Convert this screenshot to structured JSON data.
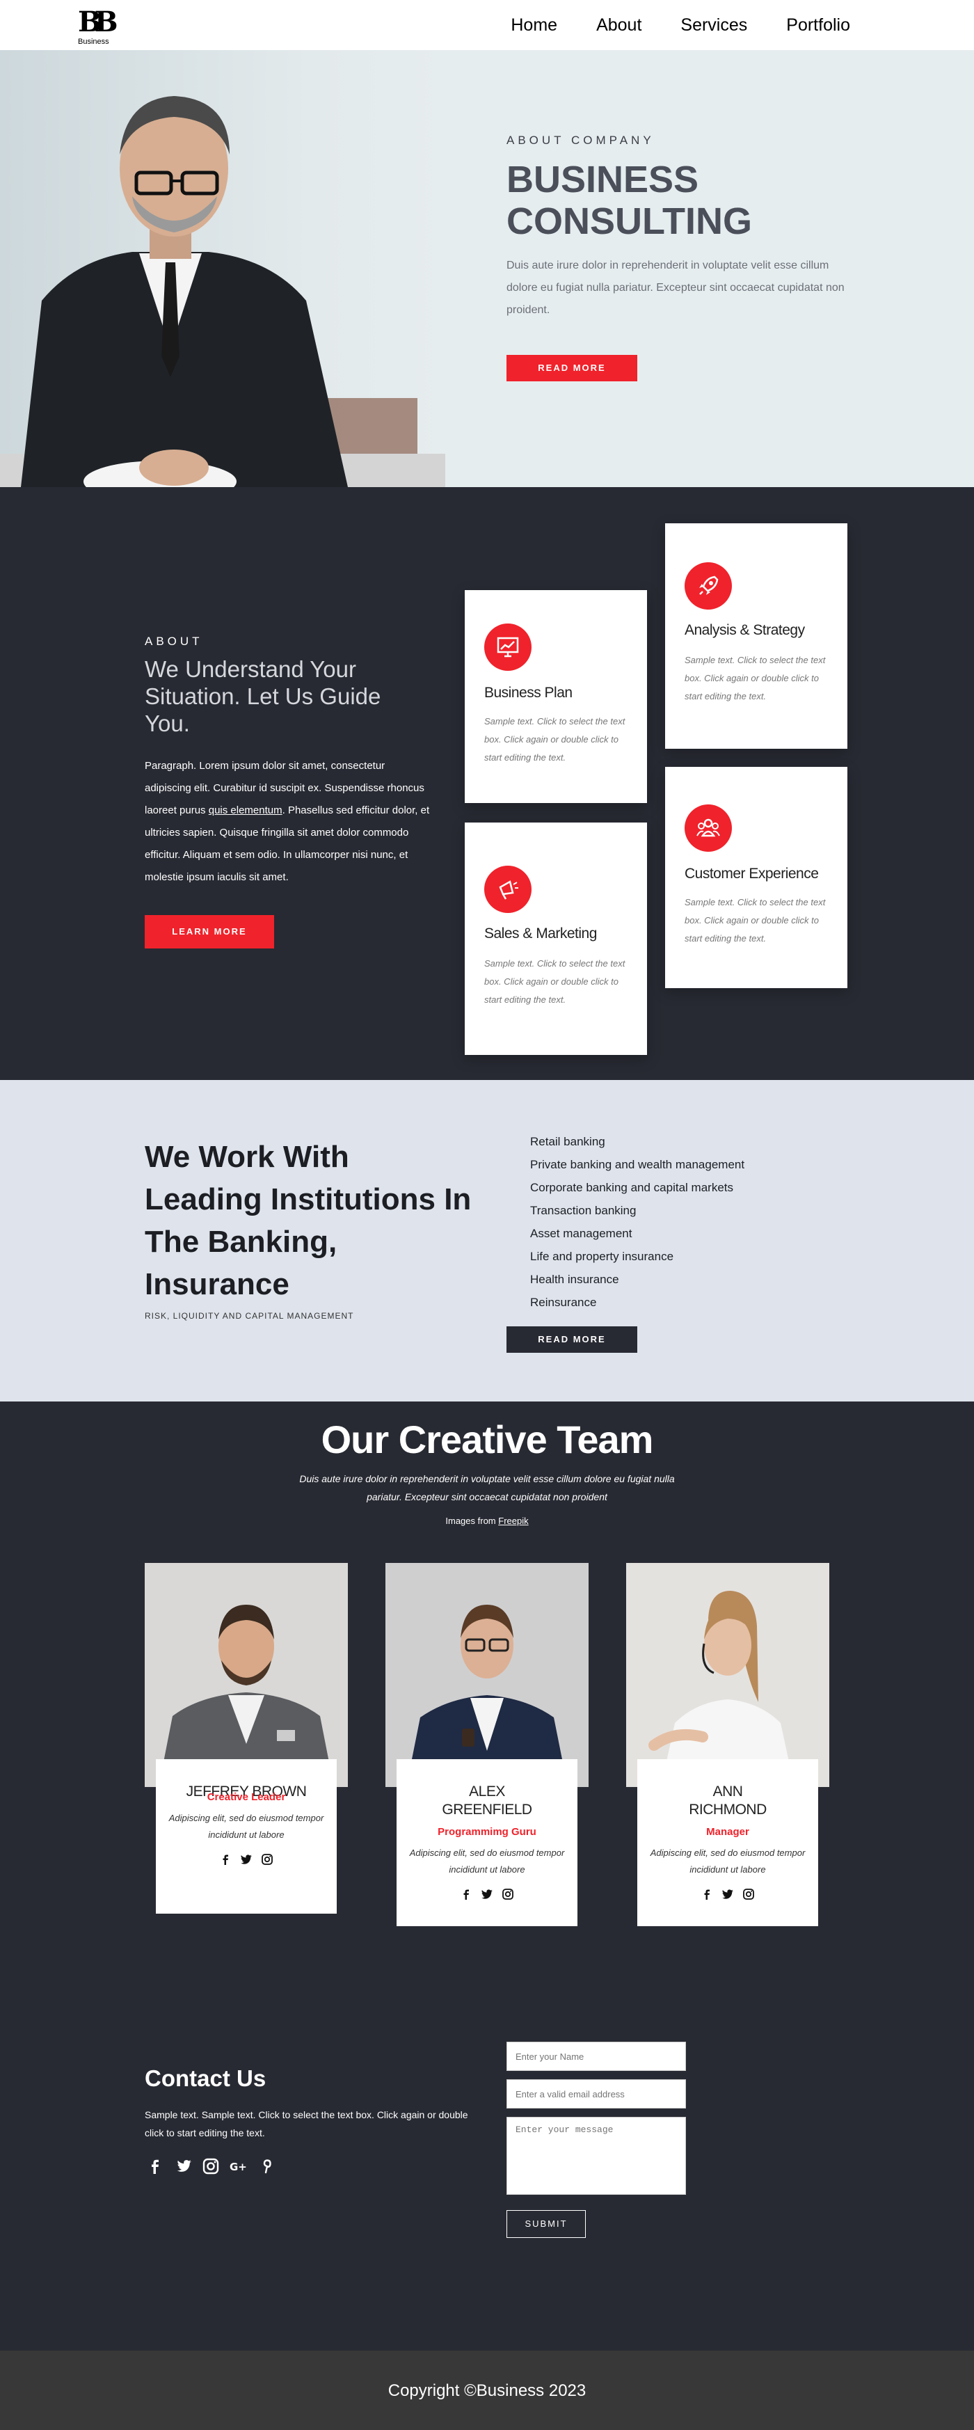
{
  "brand": {
    "logo_mark": "BB",
    "logo_text": "Business"
  },
  "nav": {
    "items": [
      "Home",
      "About",
      "Services",
      "Portfolio"
    ]
  },
  "hero": {
    "eyebrow": "ABOUT COMPANY",
    "title_line1": "BUSINESS",
    "title_line2": "CONSULTING",
    "body": "Duis aute irure dolor in reprehenderit in voluptate velit esse cillum dolore eu fugiat nulla pariatur. Excepteur sint occaecat cupidatat non proident.",
    "button": "READ MORE"
  },
  "about": {
    "eyebrow": "ABOUT",
    "title": "We Understand Your Situation. Let Us Guide You.",
    "body_start": "Paragraph. Lorem ipsum dolor sit amet, consectetur adipiscing elit. Curabitur id suscipit ex. Suspendisse rhoncus laoreet purus ",
    "body_link": "quis elementum",
    "body_end": ". Phasellus sed efficitur dolor, et ultricies sapien. Quisque fringilla sit amet dolor commodo efficitur. Aliquam et sem odio. In ullamcorper nisi nunc, et molestie ipsum iaculis sit amet.",
    "button": "LEARN MORE",
    "cards": [
      {
        "title": "Business Plan",
        "body": "Sample text. Click to select the text box. Click again or double click to start editing the text.",
        "icon": "chart-icon"
      },
      {
        "title": "Analysis & Strategy",
        "body": "Sample text. Click to select the text box. Click again or double click to start editing the text.",
        "icon": "rocket-icon"
      },
      {
        "title": "Sales & Marketing",
        "body": "Sample text. Click to select the text box. Click again or double click to start editing the text.",
        "icon": "megaphone-icon"
      },
      {
        "title": "Customer Experience",
        "body": "Sample text. Click to select the text box. Click again or double click to start editing the text.",
        "icon": "group-icon"
      }
    ]
  },
  "institutions": {
    "title": "We Work With Leading Institutions In The Banking, Insurance",
    "subtitle": "RISK, LIQUIDITY AND CAPITAL MANAGEMENT",
    "items": [
      "Retail banking",
      "Private banking and wealth management",
      "Corporate banking and capital markets",
      "Transaction banking",
      "Asset management",
      "Life and property insurance",
      "Health insurance",
      "Reinsurance"
    ],
    "button": "READ MORE"
  },
  "team": {
    "title": "Our Creative Team",
    "intro": "Duis aute irure dolor in reprehenderit in voluptate velit esse cillum dolore eu fugiat nulla pariatur. Excepteur sint occaecat cupidatat non proident",
    "credit_prefix": "Images from ",
    "credit_link": "Freepik",
    "members": [
      {
        "name_line1": "JEFFREY BROWN",
        "name_line2": "",
        "role": "Creative Leader",
        "text": "Adipiscing elit, sed do eiusmod tempor incididunt ut labore"
      },
      {
        "name_line1": "ALEX",
        "name_line2": "GREENFIELD",
        "role": "Programmimg Guru",
        "text": "Adipiscing elit, sed do eiusmod tempor incididunt ut labore"
      },
      {
        "name_line1": "ANN",
        "name_line2": "RICHMOND",
        "role": "Manager",
        "text": "Adipiscing elit, sed do eiusmod tempor incididunt ut labore"
      }
    ]
  },
  "contact": {
    "title": "Contact Us",
    "text": "Sample text. Sample text. Click to select the text box. Click again or double click to start editing the text.",
    "name_placeholder": "Enter your Name",
    "email_placeholder": "Enter a valid email address",
    "message_placeholder": "Enter your message",
    "submit": "SUBMIT"
  },
  "footer": {
    "text": "Copyright ©Business 2023"
  },
  "colors": {
    "accent": "#f0222b",
    "dark": "#282a33",
    "hero_bg": "#e6edef",
    "light_bg": "#dfe4ec"
  }
}
